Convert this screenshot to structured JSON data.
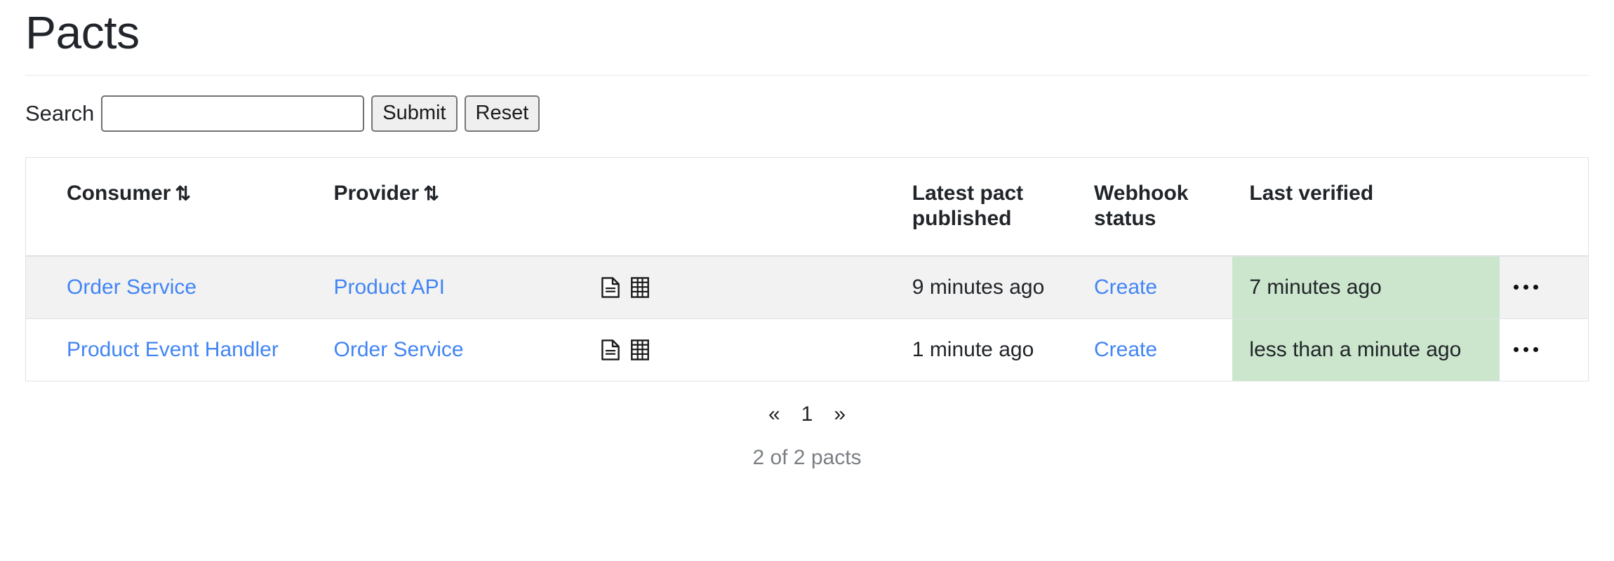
{
  "page": {
    "title": "Pacts"
  },
  "search": {
    "label": "Search",
    "value": "",
    "placeholder": "",
    "submit_label": "Submit",
    "reset_label": "Reset"
  },
  "table": {
    "columns": [
      {
        "label": "Consumer",
        "sortable": true,
        "sort_icon": "sort-updown-icon"
      },
      {
        "label": "Provider",
        "sortable": true,
        "sort_icon": "sort-updown-icon"
      },
      {
        "label": "",
        "sortable": false
      },
      {
        "label": "Latest pact published",
        "sortable": false
      },
      {
        "label": "Webhook status",
        "sortable": false
      },
      {
        "label": "Last verified",
        "sortable": false
      },
      {
        "label": "",
        "sortable": false
      }
    ],
    "rows": [
      {
        "consumer": "Order Service",
        "provider": "Product API",
        "icons": [
          "document-icon",
          "grid-icon"
        ],
        "latest_pact_published": "9 minutes ago",
        "webhook_status": "Create",
        "last_verified": "7 minutes ago",
        "actions": "ellipsis-icon"
      },
      {
        "consumer": "Product Event Handler",
        "provider": "Order Service",
        "icons": [
          "document-icon",
          "grid-icon"
        ],
        "latest_pact_published": "1 minute ago",
        "webhook_status": "Create",
        "last_verified": "less than a minute ago",
        "actions": "ellipsis-icon"
      }
    ]
  },
  "pagination": {
    "prev_label": "«",
    "next_label": "»",
    "pages": [
      "1"
    ],
    "current_page": "1"
  },
  "footer": {
    "count_text": "2 of 2 pacts"
  },
  "colors": {
    "link": "#4285f4",
    "verified_highlight": "#cbe6cc",
    "row_odd_bg": "#f2f2f2",
    "border": "#dee2e6",
    "muted_text": "#7b7f83"
  }
}
